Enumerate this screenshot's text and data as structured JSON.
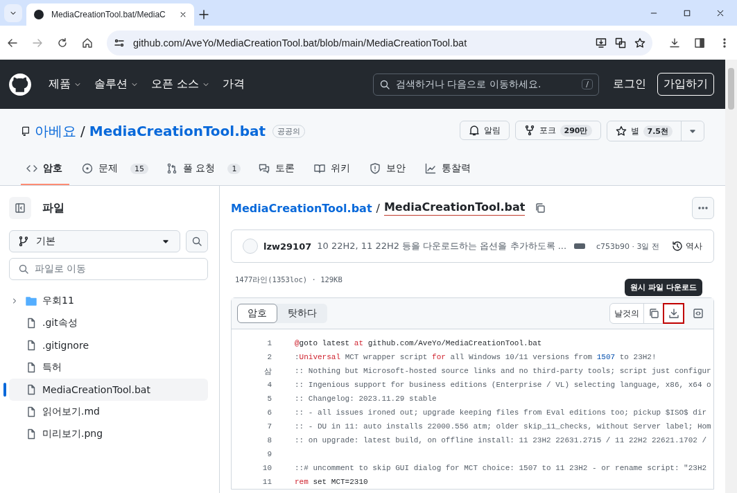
{
  "browser": {
    "tab_title": "MediaCreationTool.bat/MediaC",
    "url": "github.com/AveYo/MediaCreationTool.bat/blob/main/MediaCreationTool.bat"
  },
  "header": {
    "nav": [
      {
        "label": "제품",
        "dropdown": true
      },
      {
        "label": "솔루션",
        "dropdown": true
      },
      {
        "label": "오픈 소스",
        "dropdown": true
      },
      {
        "label": "가격",
        "dropdown": false
      }
    ],
    "search": {
      "placeholder": "검색하거나 다음으로 이동하세요.",
      "shortcut": "/"
    },
    "sign_in": "로그인",
    "sign_up": "가입하기"
  },
  "repo": {
    "owner": "아베요",
    "separator": "/",
    "name": "MediaCreationTool.bat",
    "visibility": "공공의",
    "watch": "알림",
    "fork": {
      "label": "포크",
      "count": "290만"
    },
    "star": {
      "label": "별",
      "count": "7.5천"
    }
  },
  "repo_tabs": [
    {
      "label": "암호",
      "selected": true
    },
    {
      "label": "문제",
      "count": "15",
      "selected": false
    },
    {
      "label": "풀 요청",
      "count": "1",
      "selected": false
    },
    {
      "label": "토론",
      "selected": false
    },
    {
      "label": "위키",
      "selected": false
    },
    {
      "label": "보안",
      "selected": false
    },
    {
      "label": "통찰력",
      "selected": false
    }
  ],
  "sidebar": {
    "title": "파일",
    "branch": "기본",
    "file_search": {
      "placeholder": "파일로 이동"
    },
    "tree": [
      {
        "kind": "folder",
        "name": "우회11",
        "expanded": false,
        "selected": false
      },
      {
        "kind": "file",
        "name": ".git속성",
        "selected": false
      },
      {
        "kind": "file",
        "name": ".gitignore",
        "selected": false
      },
      {
        "kind": "file",
        "name": "특허",
        "selected": false
      },
      {
        "kind": "file",
        "name": "MediaCreationTool.bat",
        "selected": true
      },
      {
        "kind": "file",
        "name": "읽어보기.md",
        "selected": false
      },
      {
        "kind": "file",
        "name": "미리보기.png",
        "selected": false
      }
    ]
  },
  "file": {
    "breadcrumb_repo": "MediaCreationTool.bat",
    "breadcrumb_separator": "/",
    "breadcrumb_file": "MediaCreationTool.bat",
    "file_underlined": true,
    "commit": {
      "author": "lzw29107",
      "message": "10 22H2, 11 22H2 등을 다운로드하는 옵션을 추가하도록 ...",
      "sha_date": "c753b90 · 3일 전",
      "history": "역사"
    },
    "meta": "1477라인(1353loc) · 129KB",
    "view_tabs": [
      {
        "label": "암호",
        "selected": true
      },
      {
        "label": "탓하다",
        "selected": false
      }
    ],
    "raw_button": "날것의",
    "download_highlighted": true,
    "download_tooltip": "원시 파일 다운로드",
    "lines": [
      {
        "number": "1",
        "segments": [
          {
            "kind": "keyword",
            "text": "@"
          },
          {
            "kind": "plain",
            "text": "goto latest "
          },
          {
            "kind": "keyword",
            "text": "at"
          },
          {
            "kind": "plain",
            "text": " github.com/AveYo/MediaCreationTool.bat"
          }
        ]
      },
      {
        "number": "2",
        "segments": [
          {
            "kind": "comment",
            "text": ":"
          },
          {
            "kind": "keyword",
            "text": "Universal"
          },
          {
            "kind": "comment",
            "text": " MCT wrapper script "
          },
          {
            "kind": "keyword",
            "text": "for"
          },
          {
            "kind": "comment",
            "text": " all Windows 10/11 versions from "
          },
          {
            "kind": "number",
            "text": "1507"
          },
          {
            "kind": "comment",
            "text": " to 23H2!"
          }
        ]
      },
      {
        "number": "삼",
        "segments": [
          {
            "kind": "comment",
            "text": ":: Nothing but Microsoft-hosted source links and no third-party tools; script just configur"
          }
        ]
      },
      {
        "number": "4",
        "segments": [
          {
            "kind": "comment",
            "text": ":: Ingenious support for business editions (Enterprise / VL) selecting language, x86, x64 o"
          }
        ]
      },
      {
        "number": "5",
        "segments": [
          {
            "kind": "comment",
            "text": ":: Changelog: 2023.11.29 stable"
          }
        ]
      },
      {
        "number": "6",
        "segments": [
          {
            "kind": "comment",
            "text": ":: - all issues ironed out; upgrade keeping files from Eval editions too; pickup $ISO$ dir"
          }
        ]
      },
      {
        "number": "7",
        "segments": [
          {
            "kind": "comment",
            "text": ":: - DU in 11: auto installs 22000.556 atm; older skip_11_checks, without Server label; Hom"
          }
        ]
      },
      {
        "number": "8",
        "segments": [
          {
            "kind": "comment",
            "text": ":: on upgrade: latest build, on offline install: 11 23H2 22631.2715 / 11 22H2 22621.1702 /"
          }
        ]
      },
      {
        "number": "9"
      },
      {
        "number": "10",
        "segments": [
          {
            "kind": "comment",
            "text": "::# uncomment to skip GUI dialog for MCT choice: 1507 to 11 23H2 - or rename script: \"23H2"
          }
        ]
      },
      {
        "number": "11",
        "segments": [
          {
            "kind": "keyword",
            "text": "rem"
          },
          {
            "kind": "plain",
            "text": " set MCT=2310"
          }
        ]
      }
    ]
  }
}
